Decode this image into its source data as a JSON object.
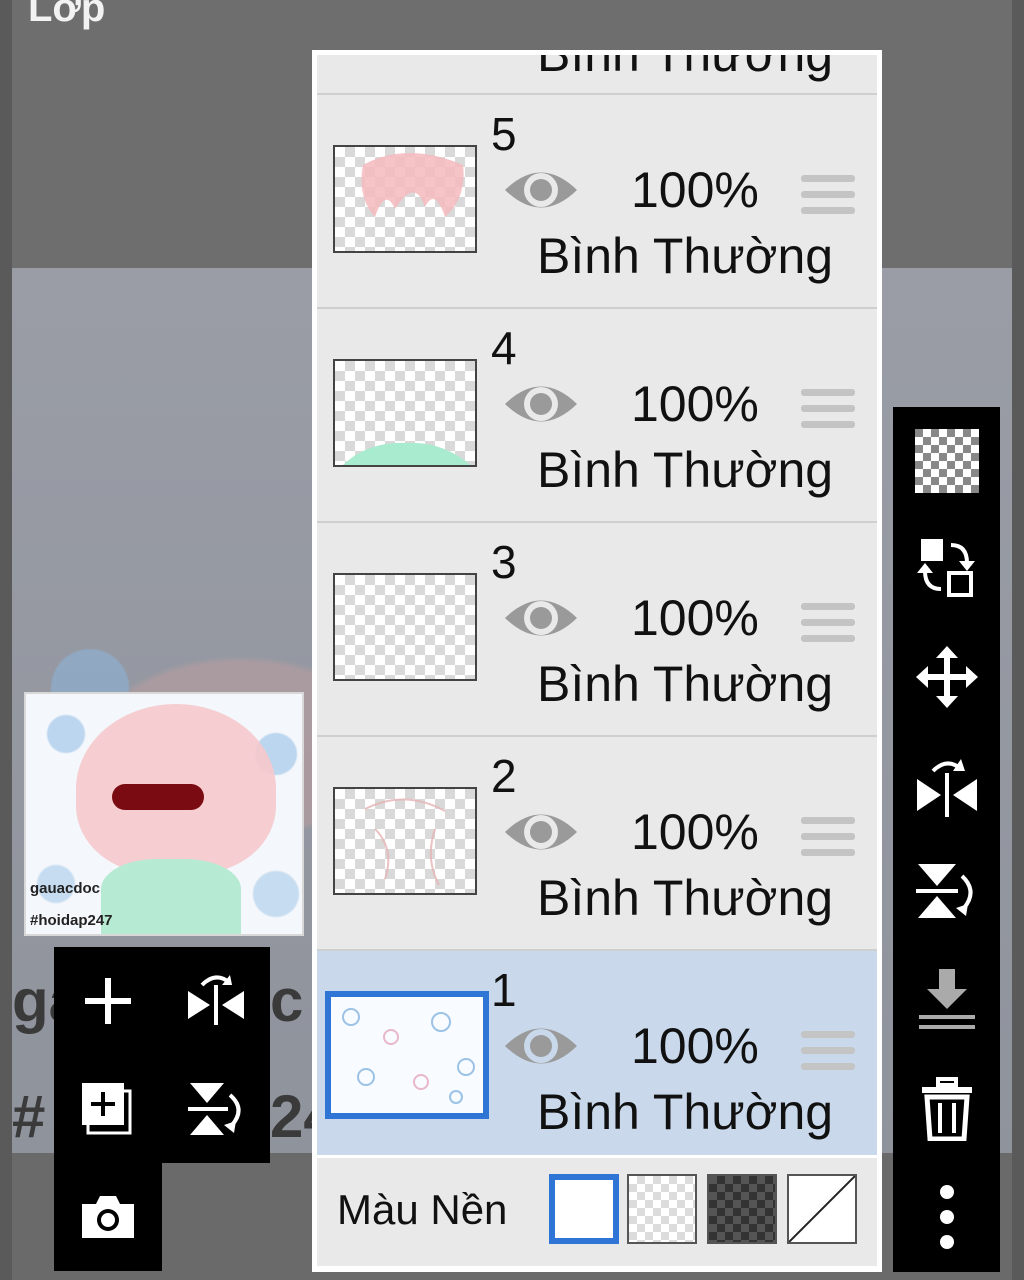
{
  "app": {
    "title": "Lớp"
  },
  "canvas": {
    "text_line1": "ga",
    "text_line1_end": "c",
    "text_line2": "#",
    "text_line2_end": "24"
  },
  "preview": {
    "watermark_name": "gauacdoc",
    "watermark_tag": "#hoidap247"
  },
  "layers": [
    {
      "number": "5",
      "opacity": "100%",
      "mode": "Bình Thường",
      "visible": true,
      "selected": false
    },
    {
      "number": "4",
      "opacity": "100%",
      "mode": "Bình Thường",
      "visible": true,
      "selected": false
    },
    {
      "number": "3",
      "opacity": "100%",
      "mode": "Bình Thường",
      "visible": true,
      "selected": false
    },
    {
      "number": "2",
      "opacity": "100%",
      "mode": "Bình Thường",
      "visible": true,
      "selected": false
    },
    {
      "number": "1",
      "opacity": "100%",
      "mode": "Bình Thường",
      "visible": true,
      "selected": true
    }
  ],
  "partial_layer": {
    "mode": "Bình Thường"
  },
  "background_row": {
    "label": "Màu Nền",
    "options": [
      "white",
      "transparent",
      "dark-checker",
      "none"
    ],
    "selected": "white"
  },
  "left_tools": [
    "add-layer",
    "flip-horizontal",
    "duplicate-layer",
    "flip-vertical",
    "camera"
  ],
  "right_tools": [
    "transparency",
    "swap-layer",
    "move",
    "flip-horizontal",
    "flip-vertical",
    "merge-down",
    "delete",
    "more"
  ],
  "colors": {
    "accent": "#2f75d6",
    "selected_row": "#c9d9eb",
    "row": "#e9e9e9",
    "toolbar": "#000000"
  }
}
